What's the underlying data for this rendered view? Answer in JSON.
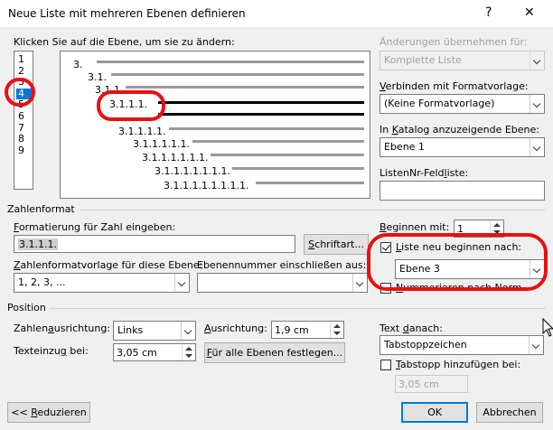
{
  "window": {
    "title": "Neue Liste mit mehreren Ebenen definieren",
    "help": "?",
    "close": "✕"
  },
  "level_picker": {
    "label": "Klicken Sie auf die Ebene, um sie zu ändern:",
    "levels": [
      "1",
      "2",
      "3",
      "4",
      "5",
      "6",
      "7",
      "8",
      "9"
    ],
    "selected": "4"
  },
  "preview": {
    "lines": [
      "3.",
      "3.1.",
      "3.1.1.",
      "3.1.1.1.",
      "3.1.1.1.1.",
      "3.1.1.1.1.1.",
      "3.1.1.1.1.1.1.",
      "3.1.1.1.1.1.1.1.",
      "3.1.1.1.1.1.1.1.1."
    ]
  },
  "apply_changes": {
    "label": "Änderungen übernehmen für:",
    "value": "Komplette Liste"
  },
  "link_style": {
    "label": "Verbinden mit Formatvorlage:",
    "value": "(Keine Formatvorlage)"
  },
  "gallery_level": {
    "label": "In Katalog anzuzeigende Ebene:",
    "value": "Ebene 1"
  },
  "listnum": {
    "label": "ListenNr-Feldliste:",
    "value": ""
  },
  "number_format": {
    "group_label": "Zahlenformat",
    "format_label": "Formatierung für Zahl eingeben:",
    "format_value": "3.1.1.1.",
    "font_button": "Schriftart...",
    "style_label": "Zahlenformatvorlage für diese Ebene:",
    "style_value": "1, 2, 3, ...",
    "include_label": "Ebenennummer einschließen aus:",
    "include_value": "",
    "start_label": "Beginnen mit:",
    "start_value": "1",
    "restart_label": "Liste neu beginnen nach:",
    "restart_checked": true,
    "restart_value": "Ebene 3",
    "legal_label": "Nummerieren nach Norm",
    "legal_checked": false
  },
  "position": {
    "group_label": "Position",
    "align_label": "Zahlenausrichtung:",
    "align_value": "Links",
    "alignat_label": "Ausrichtung:",
    "alignat_value": "1,9 cm",
    "indent_label": "Texteinzug bei:",
    "indent_value": "3,05 cm",
    "set_all_button": "Für alle Ebenen festlegen...",
    "follow_label": "Text danach:",
    "follow_value": "Tabstoppzeichen",
    "tabstop_label": "Tabstopp hinzufügen bei:",
    "tabstop_checked": false,
    "tabstop_value": "3,05 cm"
  },
  "footer": {
    "less": "<< Reduzieren",
    "ok": "OK",
    "cancel": "Abbrechen"
  },
  "colors": {
    "accent": "#0078d7",
    "highlight": "#e81010",
    "selection": "#0078d7"
  }
}
